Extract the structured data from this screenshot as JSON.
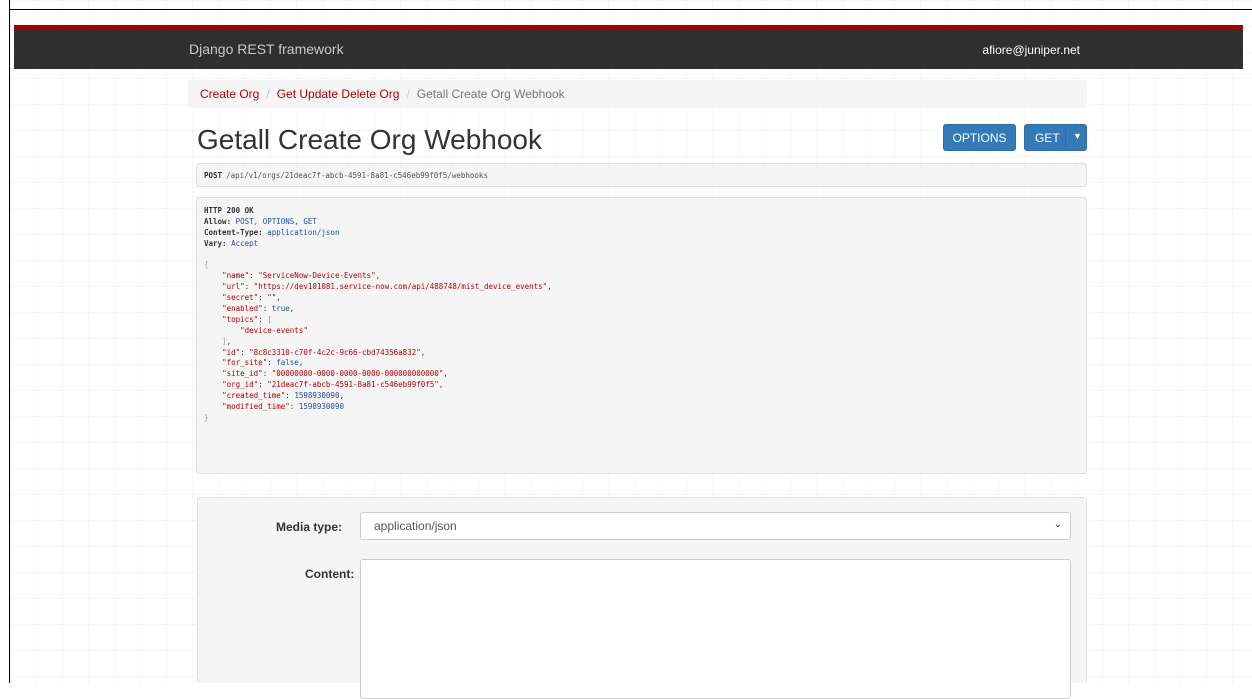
{
  "navbar": {
    "brand": "Django REST framework",
    "user": "afiore@juniper.net"
  },
  "breadcrumb": [
    {
      "label": "Create Org"
    },
    {
      "label": "Get Update Delete Org"
    },
    {
      "label": "Getall Create Org Webhook"
    }
  ],
  "page": {
    "title": "Getall Create Org Webhook"
  },
  "buttons": {
    "options": "OPTIONS",
    "get": "GET"
  },
  "request": {
    "method": "POST",
    "path": "/api/v1/orgs/21deac7f-abcb-4591-8a81-c546eb99f0f5/webhooks"
  },
  "response": {
    "status": "HTTP 200 OK",
    "headers": [
      {
        "key": "Allow:",
        "value": "POST, OPTIONS, GET"
      },
      {
        "key": "Content-Type:",
        "value": "application/json"
      },
      {
        "key": "Vary:",
        "value": "Accept"
      }
    ],
    "body": {
      "name": "ServiceNow-Device-Events",
      "url": "https://dev101081.service-now.com/api/488748/mist_device_events",
      "secret": "",
      "enabled": "true",
      "topics": [
        "device-events"
      ],
      "id": "8c8c3310-c70f-4c2c-9c66-cbd74356a832",
      "for_site": "false",
      "site_id": "00000000-0000-0000-0000-000000000000",
      "org_id": "21deac7f-abcb-4591-8a81-c546eb99f0f5",
      "created_time": "1598930090",
      "modified_time": "1598930090"
    }
  },
  "form": {
    "media_type_label": "Media type:",
    "media_type_value": "application/json",
    "content_label": "Content:"
  },
  "colors": {
    "navbar_bg": "#2f2f2f",
    "navbar_accent": "#a30000",
    "link": "#b30000",
    "button": "#337ab7"
  }
}
